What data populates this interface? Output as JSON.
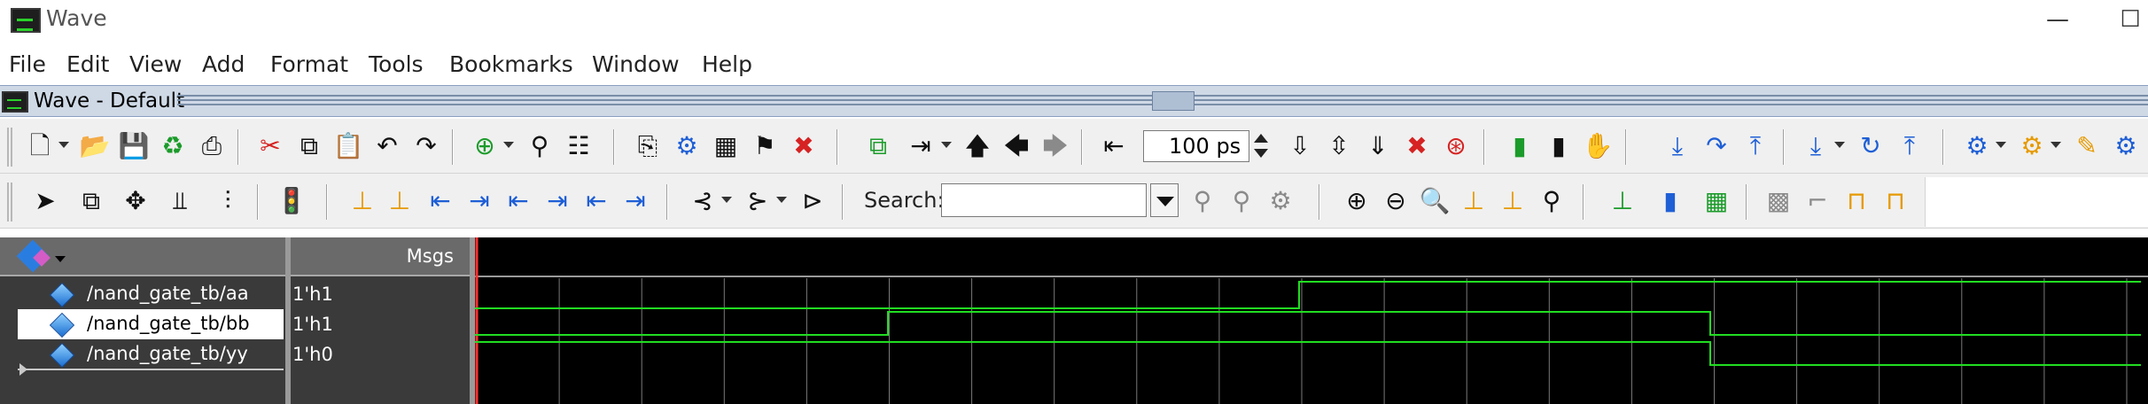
{
  "window": {
    "title": "Wave"
  },
  "menu": [
    "File",
    "Edit",
    "View",
    "Add",
    "Format",
    "Tools",
    "Bookmarks",
    "Window",
    "Help"
  ],
  "subwindow": {
    "title": "Wave - Default"
  },
  "toolbar": {
    "time_value": "100 ps",
    "search_label": "Search:",
    "search_value": ""
  },
  "wave": {
    "msgs_header": "Msgs",
    "signals": [
      {
        "name": "/nand_gate_tb/aa",
        "value": "1'h1"
      },
      {
        "name": "/nand_gate_tb/bb",
        "value": "1'h1"
      },
      {
        "name": "/nand_gate_tb/yy",
        "value": "1'h0"
      }
    ],
    "colors": {
      "trace": "#22dd22",
      "grid": "#7a7a7a",
      "background": "#000000",
      "cursor": "#ff3030"
    }
  }
}
